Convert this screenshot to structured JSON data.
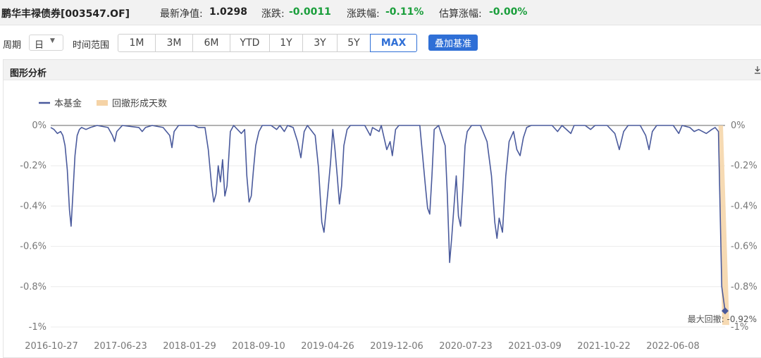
{
  "header": {
    "fund_name": "鹏华丰禄债券[003547.OF]",
    "nav_label": "最新净值:",
    "nav_value": "1.0298",
    "change_label": "涨跌:",
    "change_value": "-0.0011",
    "change_pct_label": "涨跌幅:",
    "change_pct_value": "-0.11%",
    "est_label": "估算涨幅:",
    "est_value": "-0.00%"
  },
  "toolbar": {
    "period_label": "周期",
    "period_value": "日",
    "range_label": "时间范围",
    "ranges": [
      "1M",
      "3M",
      "6M",
      "YTD",
      "1Y",
      "3Y",
      "5Y",
      "MAX"
    ],
    "active_range": "MAX",
    "benchmark_button": "叠加基准"
  },
  "panel": {
    "title": "图形分析"
  },
  "colors": {
    "fund_line": "#4a5a9c",
    "drawdown_bar": "#f5d3a6",
    "accent": "#2f6fd6",
    "positive_green": "#1a9e3b"
  },
  "chart_data": {
    "type": "line",
    "legend": [
      {
        "name": "本基金",
        "color": "#4a5a9c",
        "marker": "line"
      },
      {
        "name": "回撤形成天数",
        "color": "#f5d3a6",
        "marker": "bar"
      }
    ],
    "y_ticks": [
      "0%",
      "-0.2%",
      "-0.4%",
      "-0.6%",
      "-0.8%",
      "-1%"
    ],
    "y_right_ticks": [
      "0%",
      "-0.2%",
      "-0.4%",
      "-0.6%",
      "-0.8%",
      "-1%"
    ],
    "ylim": [
      -1.0,
      0
    ],
    "x_ticks": [
      "2016-10-27",
      "2017-06-23",
      "2018-01-29",
      "2018-09-10",
      "2019-04-26",
      "2019-12-06",
      "2020-07-23",
      "2021-03-09",
      "2021-10-22",
      "2022-06-08"
    ],
    "grid": true,
    "legend_position": "top-left",
    "max_drawdown_label": "最大回撤: -0.92%",
    "max_drawdown_value": -0.92,
    "series": [
      {
        "name": "本基金",
        "points": [
          [
            0.0,
            -0.01
          ],
          [
            0.3,
            -0.02
          ],
          [
            0.6,
            -0.04
          ],
          [
            0.9,
            -0.03
          ],
          [
            1.1,
            -0.05
          ],
          [
            1.3,
            -0.1
          ],
          [
            1.5,
            -0.22
          ],
          [
            1.7,
            -0.42
          ],
          [
            1.85,
            -0.5
          ],
          [
            2.0,
            -0.35
          ],
          [
            2.2,
            -0.15
          ],
          [
            2.4,
            -0.05
          ],
          [
            2.6,
            -0.02
          ],
          [
            2.8,
            -0.01
          ],
          [
            3.2,
            -0.02
          ],
          [
            3.6,
            -0.01
          ],
          [
            4.2,
            0.0
          ],
          [
            5.2,
            -0.01
          ],
          [
            5.6,
            -0.05
          ],
          [
            5.8,
            -0.08
          ],
          [
            6.0,
            -0.03
          ],
          [
            6.5,
            0.0
          ],
          [
            8.0,
            -0.01
          ],
          [
            8.3,
            -0.03
          ],
          [
            8.6,
            -0.01
          ],
          [
            9.2,
            0.0
          ],
          [
            10.2,
            -0.01
          ],
          [
            10.5,
            -0.03
          ],
          [
            10.8,
            -0.05
          ],
          [
            11.0,
            -0.11
          ],
          [
            11.2,
            -0.03
          ],
          [
            11.6,
            0.0
          ],
          [
            13.0,
            0.0
          ],
          [
            13.4,
            -0.01
          ],
          [
            14.0,
            -0.01
          ],
          [
            14.3,
            -0.12
          ],
          [
            14.6,
            -0.3
          ],
          [
            14.8,
            -0.38
          ],
          [
            15.0,
            -0.34
          ],
          [
            15.2,
            -0.2
          ],
          [
            15.4,
            -0.28
          ],
          [
            15.6,
            -0.17
          ],
          [
            15.8,
            -0.35
          ],
          [
            16.0,
            -0.3
          ],
          [
            16.3,
            -0.03
          ],
          [
            16.6,
            0.0
          ],
          [
            17.3,
            -0.04
          ],
          [
            17.6,
            -0.02
          ],
          [
            17.8,
            -0.25
          ],
          [
            18.0,
            -0.38
          ],
          [
            18.2,
            -0.35
          ],
          [
            18.4,
            -0.22
          ],
          [
            18.6,
            -0.1
          ],
          [
            18.9,
            -0.03
          ],
          [
            19.2,
            0.0
          ],
          [
            20.0,
            0.0
          ],
          [
            20.5,
            -0.02
          ],
          [
            20.8,
            0.0
          ],
          [
            21.2,
            -0.03
          ],
          [
            21.5,
            0.0
          ],
          [
            22.0,
            -0.01
          ],
          [
            22.4,
            -0.08
          ],
          [
            22.7,
            -0.16
          ],
          [
            23.0,
            -0.03
          ],
          [
            23.3,
            0.0
          ],
          [
            24.0,
            -0.05
          ],
          [
            24.3,
            -0.21
          ],
          [
            24.6,
            -0.48
          ],
          [
            24.8,
            -0.53
          ],
          [
            25.0,
            -0.42
          ],
          [
            25.2,
            -0.3
          ],
          [
            25.4,
            -0.18
          ],
          [
            25.6,
            -0.02
          ],
          [
            25.8,
            -0.12
          ],
          [
            26.0,
            -0.25
          ],
          [
            26.2,
            -0.39
          ],
          [
            26.4,
            -0.3
          ],
          [
            26.6,
            -0.1
          ],
          [
            26.9,
            -0.02
          ],
          [
            27.2,
            0.0
          ],
          [
            28.5,
            0.0
          ],
          [
            29.0,
            -0.05
          ],
          [
            29.2,
            -0.01
          ],
          [
            29.8,
            -0.03
          ],
          [
            30.0,
            0.0
          ],
          [
            30.5,
            -0.12
          ],
          [
            30.8,
            -0.08
          ],
          [
            31.0,
            -0.15
          ],
          [
            31.3,
            -0.02
          ],
          [
            31.6,
            0.0
          ],
          [
            33.5,
            0.0
          ],
          [
            34.0,
            -0.3
          ],
          [
            34.2,
            -0.41
          ],
          [
            34.4,
            -0.44
          ],
          [
            34.6,
            -0.25
          ],
          [
            34.8,
            -0.02
          ],
          [
            35.2,
            0.0
          ],
          [
            35.8,
            -0.1
          ],
          [
            36.0,
            -0.35
          ],
          [
            36.2,
            -0.68
          ],
          [
            36.4,
            -0.55
          ],
          [
            36.6,
            -0.4
          ],
          [
            36.8,
            -0.25
          ],
          [
            37.0,
            -0.45
          ],
          [
            37.2,
            -0.5
          ],
          [
            37.4,
            -0.32
          ],
          [
            37.6,
            -0.1
          ],
          [
            37.8,
            -0.03
          ],
          [
            38.2,
            0.0
          ],
          [
            39.0,
            0.0
          ],
          [
            39.6,
            -0.08
          ],
          [
            40.0,
            -0.25
          ],
          [
            40.3,
            -0.48
          ],
          [
            40.5,
            -0.56
          ],
          [
            40.7,
            -0.46
          ],
          [
            41.0,
            -0.53
          ],
          [
            41.3,
            -0.25
          ],
          [
            41.6,
            -0.08
          ],
          [
            42.0,
            -0.03
          ],
          [
            42.3,
            -0.12
          ],
          [
            42.6,
            -0.15
          ],
          [
            42.9,
            -0.06
          ],
          [
            43.2,
            -0.01
          ],
          [
            43.6,
            0.0
          ],
          [
            45.5,
            0.0
          ],
          [
            46.0,
            -0.03
          ],
          [
            46.4,
            0.0
          ],
          [
            47.2,
            -0.04
          ],
          [
            47.5,
            0.0
          ],
          [
            48.5,
            0.0
          ],
          [
            49.0,
            -0.02
          ],
          [
            49.4,
            0.0
          ],
          [
            50.5,
            0.0
          ],
          [
            51.2,
            -0.04
          ],
          [
            51.6,
            -0.12
          ],
          [
            52.0,
            -0.03
          ],
          [
            52.4,
            0.0
          ],
          [
            53.5,
            0.0
          ],
          [
            54.0,
            -0.05
          ],
          [
            54.3,
            -0.12
          ],
          [
            54.6,
            -0.03
          ],
          [
            55.0,
            0.0
          ],
          [
            56.5,
            0.0
          ],
          [
            57.0,
            -0.04
          ],
          [
            57.3,
            0.0
          ],
          [
            58.0,
            -0.01
          ],
          [
            58.4,
            -0.03
          ],
          [
            58.8,
            -0.02
          ],
          [
            59.5,
            -0.04
          ],
          [
            60.0,
            -0.02
          ],
          [
            60.3,
            -0.01
          ],
          [
            60.6,
            -0.03
          ],
          [
            60.9,
            -0.8
          ],
          [
            61.2,
            -0.92
          ]
        ]
      },
      {
        "name": "回撤形成天数",
        "points": [
          [
            60.6,
            0.0
          ],
          [
            61.2,
            -0.99
          ]
        ]
      }
    ]
  }
}
